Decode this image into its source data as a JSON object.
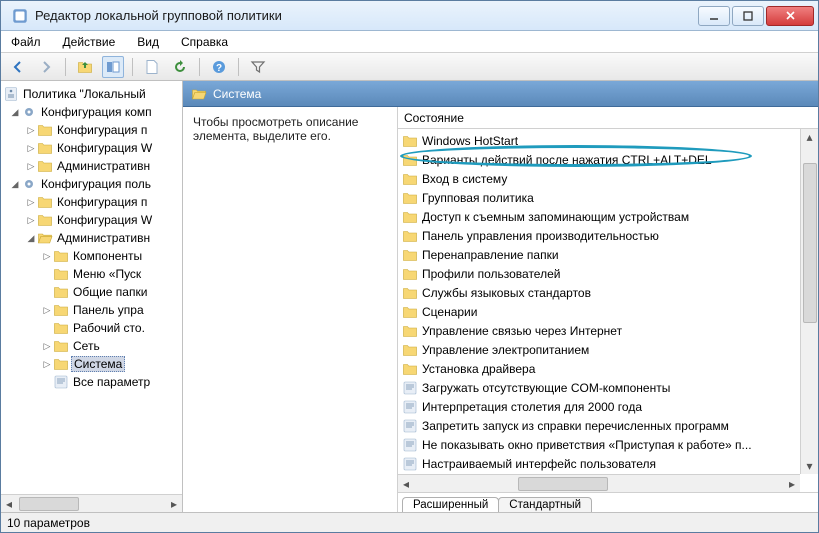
{
  "window": {
    "title": "Редактор локальной групповой политики"
  },
  "menu": {
    "file": "Файл",
    "action": "Действие",
    "view": "Вид",
    "help": "Справка"
  },
  "tree": {
    "root": "Политика \"Локальный",
    "comp_conf": "Конфигурация комп",
    "comp_soft": "Конфигурация п",
    "comp_win": "Конфигурация W",
    "comp_admin": "Административн",
    "user_conf": "Конфигурация поль",
    "user_soft": "Конфигурация п",
    "user_win": "Конфигурация W",
    "user_admin": "Административн",
    "components": "Компоненты",
    "start_menu": "Меню «Пуск",
    "shared_folders": "Общие папки",
    "control_panel": "Панель упра",
    "desktop": "Рабочий сто.",
    "network": "Сеть",
    "system": "Система",
    "all_params": "Все параметр"
  },
  "right": {
    "header": "Система",
    "description": "Чтобы просмотреть описание элемента, выделите его.",
    "column": "Состояние"
  },
  "items": [
    {
      "type": "folder",
      "label": "Windows HotStart"
    },
    {
      "type": "folder",
      "label": "Варианты действий после нажатия CTRL+ALT+DEL"
    },
    {
      "type": "folder",
      "label": "Вход в систему"
    },
    {
      "type": "folder",
      "label": "Групповая политика"
    },
    {
      "type": "folder",
      "label": "Доступ к съемным запоминающим устройствам"
    },
    {
      "type": "folder",
      "label": "Панель управления производительностью"
    },
    {
      "type": "folder",
      "label": "Перенаправление папки"
    },
    {
      "type": "folder",
      "label": "Профили пользователей"
    },
    {
      "type": "folder",
      "label": "Службы языковых стандартов"
    },
    {
      "type": "folder",
      "label": "Сценарии"
    },
    {
      "type": "folder",
      "label": "Управление связью через Интернет"
    },
    {
      "type": "folder",
      "label": "Управление электропитанием"
    },
    {
      "type": "folder",
      "label": "Установка драйвера"
    },
    {
      "type": "setting",
      "label": "Загружать отсутствующие COM-компоненты"
    },
    {
      "type": "setting",
      "label": "Интерпретация столетия для 2000 года"
    },
    {
      "type": "setting",
      "label": "Запретить запуск из справки перечисленных программ"
    },
    {
      "type": "setting",
      "label": "Не показывать окно приветствия «Приступая к работе» п..."
    },
    {
      "type": "setting",
      "label": "Настраиваемый интерфейс пользователя"
    }
  ],
  "tabs": {
    "extended": "Расширенный",
    "standard": "Стандартный"
  },
  "status": "10 параметров"
}
